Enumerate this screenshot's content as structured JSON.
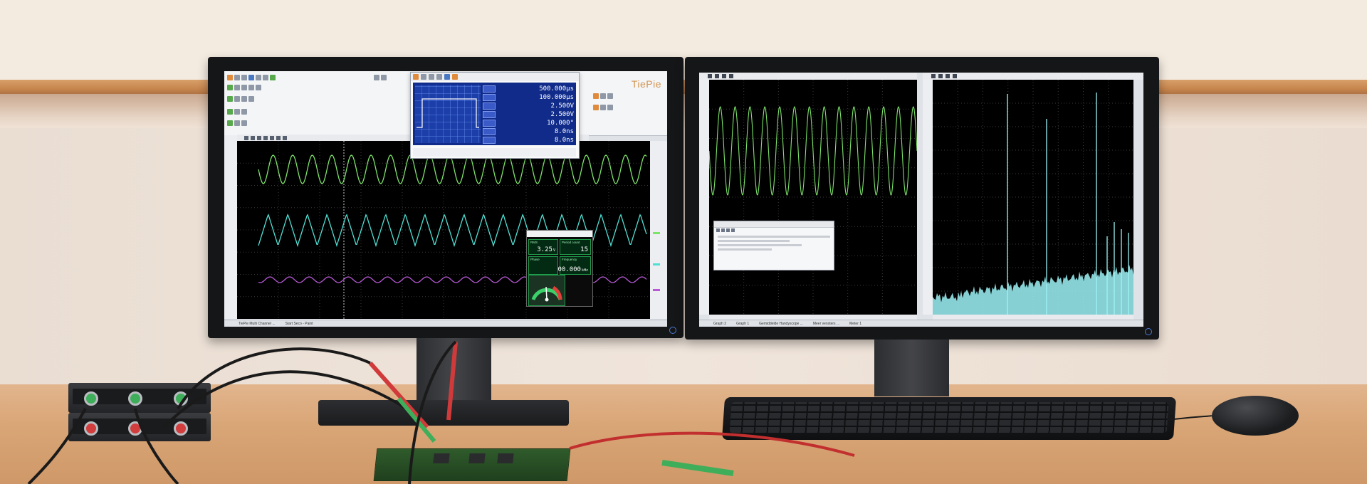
{
  "brand": {
    "logo_text": "TiePie"
  },
  "generator_panel": {
    "values": [
      {
        "value": "500.000",
        "unit": "µs"
      },
      {
        "value": "100.000",
        "unit": "µs"
      },
      {
        "value": "2.500",
        "unit": "V"
      },
      {
        "value": "2.500",
        "unit": "V"
      },
      {
        "value": "10.000",
        "unit": "°"
      },
      {
        "value": "8.0",
        "unit": "ns"
      },
      {
        "value": "8.0",
        "unit": "ns"
      }
    ]
  },
  "meter_panel": {
    "rms": {
      "caption": "RMS",
      "value": "3.25",
      "unit": "V"
    },
    "period_count": {
      "caption": "Period count",
      "value": "15"
    },
    "frequency": {
      "caption": "Frequency",
      "value": "400.000",
      "unit": "kHz"
    },
    "phase": {
      "caption": "Phase"
    }
  },
  "taskbar_left": {
    "items": [
      "TiePie Multi Channel ...",
      "Start Seco - Paint"
    ]
  },
  "taskbar_right": {
    "items": [
      "Graph 2",
      "Graph 1",
      "Gemiddelde Handyscope ...",
      "Meer vensters ...",
      "Meter 1"
    ]
  },
  "colors": {
    "trace_green": "#7de36a",
    "trace_cyan": "#4fe0d4",
    "trace_purple": "#b85ad6",
    "spectrum_cyan": "#9ef3f7",
    "generator_blue": "#102b8a",
    "meter_green": "#1f9c4a"
  }
}
